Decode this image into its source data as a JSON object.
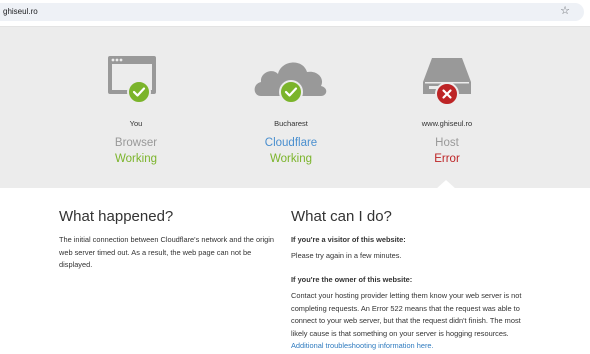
{
  "browser": {
    "url": "ghiseul.ro",
    "bookmark_icon": "star-icon"
  },
  "status": {
    "you": {
      "location": "You",
      "role": "Browser",
      "state": "Working",
      "icon": "browser-window-icon"
    },
    "cloudflare": {
      "location": "Bucharest",
      "role": "Cloudflare",
      "state": "Working",
      "icon": "cloud-icon"
    },
    "host": {
      "location": "www.ghiseul.ro",
      "role": "Host",
      "state": "Error",
      "icon": "server-icon"
    }
  },
  "what_happened": {
    "title": "What happened?",
    "body": "The initial connection between Cloudflare's network and the origin web server timed out. As a result, the web page can not be displayed."
  },
  "what_can_i_do": {
    "title": "What can I do?",
    "visitor_heading": "If you're a visitor of this website:",
    "visitor_body": "Please try again in a few minutes.",
    "owner_heading": "If you're the owner of this website:",
    "owner_body": "Contact your hosting provider letting them know your web server is not completing requests. An Error 522 means that the request was able to connect to your web server, but that the request didn't finish. The most likely cause is that something on your server is hogging resources.",
    "owner_link": "Additional troubleshooting information here."
  },
  "colors": {
    "working": "#7bb42b",
    "error": "#bd2426",
    "link": "#4a8fcf",
    "band": "#ececec"
  }
}
